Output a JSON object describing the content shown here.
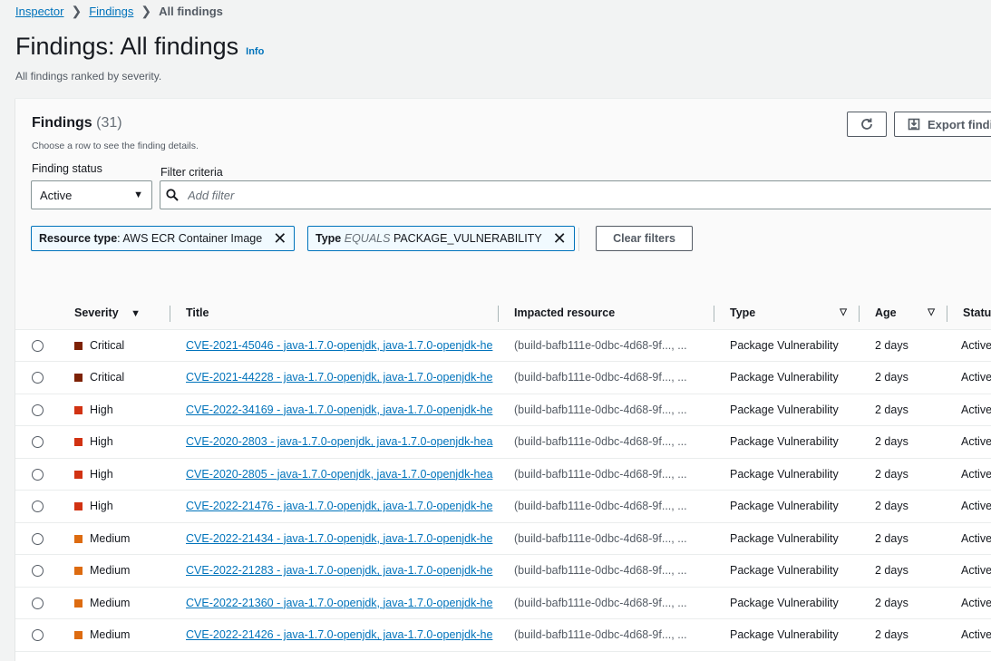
{
  "breadcrumb": {
    "item1": "Inspector",
    "item2": "Findings",
    "current": "All findings"
  },
  "page": {
    "title": "Findings: All findings",
    "info": "Info",
    "description": "All findings ranked by severity."
  },
  "panel": {
    "title": "Findings",
    "count": "(31)",
    "subtitle": "Choose a row to see the finding details.",
    "export_label": "Export findi",
    "refresh_icon": "refresh-icon",
    "export_icon": "download-icon"
  },
  "filters": {
    "status_label": "Finding status",
    "status_value": "Active",
    "criteria_label": "Filter criteria",
    "search_placeholder": "Add filter",
    "token1": {
      "key": "Resource type",
      "value": ": AWS ECR Container Image"
    },
    "token2": {
      "key": "Type",
      "operator": "EQUALS",
      "value": "PACKAGE_VULNERABILITY"
    },
    "clear_label": "Clear filters"
  },
  "table": {
    "headers": {
      "severity": "Severity",
      "title": "Title",
      "resource": "Impacted resource",
      "type": "Type",
      "age": "Age",
      "status": "Status"
    },
    "rows": [
      {
        "severity": "Critical",
        "title": "CVE-2021-45046 - java-1.7.0-openjdk, java-1.7.0-openjdk-he",
        "resource": "(build-bafb111e-0dbc-4d68-9f..., ...",
        "type": "Package Vulnerability",
        "age": "2 days",
        "status": "Active"
      },
      {
        "severity": "Critical",
        "title": "CVE-2021-44228 - java-1.7.0-openjdk, java-1.7.0-openjdk-he",
        "resource": "(build-bafb111e-0dbc-4d68-9f..., ...",
        "type": "Package Vulnerability",
        "age": "2 days",
        "status": "Active"
      },
      {
        "severity": "High",
        "title": "CVE-2022-34169 - java-1.7.0-openjdk, java-1.7.0-openjdk-he",
        "resource": "(build-bafb111e-0dbc-4d68-9f..., ...",
        "type": "Package Vulnerability",
        "age": "2 days",
        "status": "Active"
      },
      {
        "severity": "High",
        "title": "CVE-2020-2803 - java-1.7.0-openjdk, java-1.7.0-openjdk-hea",
        "resource": "(build-bafb111e-0dbc-4d68-9f..., ...",
        "type": "Package Vulnerability",
        "age": "2 days",
        "status": "Active"
      },
      {
        "severity": "High",
        "title": "CVE-2020-2805 - java-1.7.0-openjdk, java-1.7.0-openjdk-hea",
        "resource": "(build-bafb111e-0dbc-4d68-9f..., ...",
        "type": "Package Vulnerability",
        "age": "2 days",
        "status": "Active"
      },
      {
        "severity": "High",
        "title": "CVE-2022-21476 - java-1.7.0-openjdk, java-1.7.0-openjdk-he",
        "resource": "(build-bafb111e-0dbc-4d68-9f..., ...",
        "type": "Package Vulnerability",
        "age": "2 days",
        "status": "Active"
      },
      {
        "severity": "Medium",
        "title": "CVE-2022-21434 - java-1.7.0-openjdk, java-1.7.0-openjdk-he",
        "resource": "(build-bafb111e-0dbc-4d68-9f..., ...",
        "type": "Package Vulnerability",
        "age": "2 days",
        "status": "Active"
      },
      {
        "severity": "Medium",
        "title": "CVE-2022-21283 - java-1.7.0-openjdk, java-1.7.0-openjdk-he",
        "resource": "(build-bafb111e-0dbc-4d68-9f..., ...",
        "type": "Package Vulnerability",
        "age": "2 days",
        "status": "Active"
      },
      {
        "severity": "Medium",
        "title": "CVE-2022-21360 - java-1.7.0-openjdk, java-1.7.0-openjdk-he",
        "resource": "(build-bafb111e-0dbc-4d68-9f..., ...",
        "type": "Package Vulnerability",
        "age": "2 days",
        "status": "Active"
      },
      {
        "severity": "Medium",
        "title": "CVE-2022-21426 - java-1.7.0-openjdk, java-1.7.0-openjdk-he",
        "resource": "(build-bafb111e-0dbc-4d68-9f..., ...",
        "type": "Package Vulnerability",
        "age": "2 days",
        "status": "Active"
      }
    ]
  },
  "colors": {
    "critical": "#7d2105",
    "high": "#d13212",
    "medium": "#dd6b10",
    "link": "#0073bb"
  }
}
